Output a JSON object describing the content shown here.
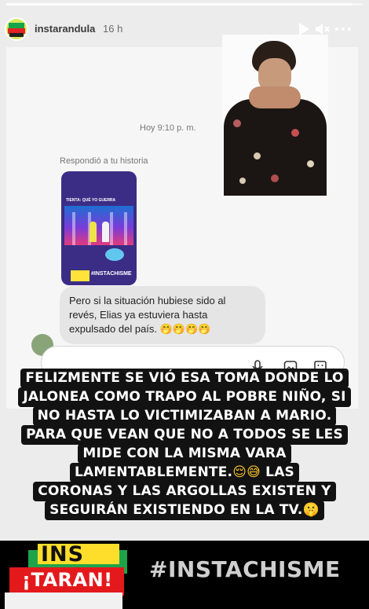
{
  "header": {
    "username": "instarandula",
    "time": "16 h",
    "progress": 0.97
  },
  "dm": {
    "timestamp": "Hoy 9:10 p. m.",
    "replied_label": "Respondió a tu historia",
    "story_thumb": {
      "caption": "TIENTA: QUÉ YO GUERRA",
      "tag": "#INSTACHISME"
    },
    "message": "Pero si la situación hubiese sido al revés, Elias ya estuviera hasta expulsado del país.",
    "message_emojis": "🤭🤭🤭🤭"
  },
  "caption": {
    "lines": [
      "FELIZMENTE SE VIÓ ESA TOMA DONDE LO",
      "JALONEA COMO TRAPO AL POBRE NIÑO, SI",
      "NO HASTA LO VICTIMIZABAN A MARIO.",
      "PARA QUE VEAN QUE NO A TODOS SE LES",
      "MIDE CON LA MISMA VARA",
      "LAMENTABLEMENTE.",
      "LAS",
      "CORONAS Y LAS ARGOLLAS EXISTEN Y",
      "SEGUIRÁN EXISTIENDO EN LA TV."
    ],
    "emojis_line6": "😌😅",
    "emoji_line9": "🤫"
  },
  "banner": {
    "logo_top": "INS",
    "logo_bottom": "¡TARAN!",
    "hashtag": "#INSTACHISME"
  },
  "icons": {
    "play": "play-icon",
    "mute": "mute-icon",
    "more": "more-icon"
  }
}
